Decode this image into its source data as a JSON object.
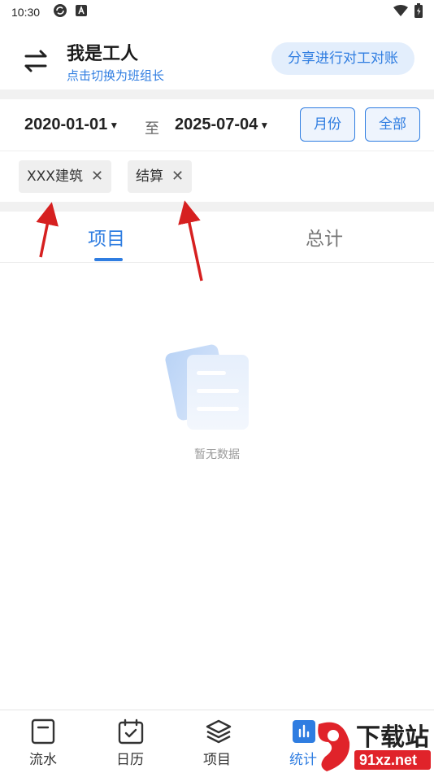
{
  "status_bar": {
    "time": "10:30"
  },
  "header": {
    "title": "我是工人",
    "switch_link": "点击切换为班组长",
    "share_button": "分享进行对工对账"
  },
  "date_filter": {
    "start_date": "2020-01-01",
    "separator": "至",
    "end_date": "2025-07-04",
    "month_button": "月份",
    "all_button": "全部"
  },
  "filter_tags": [
    {
      "label": "XXX建筑"
    },
    {
      "label": "结算"
    }
  ],
  "tabs": [
    {
      "label": "项目",
      "active": true
    },
    {
      "label": "总计",
      "active": false
    }
  ],
  "empty_state": {
    "text": "暂无数据"
  },
  "bottom_nav": [
    {
      "label": "流水",
      "icon": "ledger-icon"
    },
    {
      "label": "日历",
      "icon": "calendar-icon"
    },
    {
      "label": "项目",
      "icon": "layers-icon"
    },
    {
      "label": "统计",
      "icon": "stats-icon",
      "active": true
    }
  ],
  "watermark": {
    "text": "下载站",
    "domain": "91xz.net"
  },
  "colors": {
    "accent": "#2f7de1",
    "annotation_arrow": "#d62020"
  }
}
